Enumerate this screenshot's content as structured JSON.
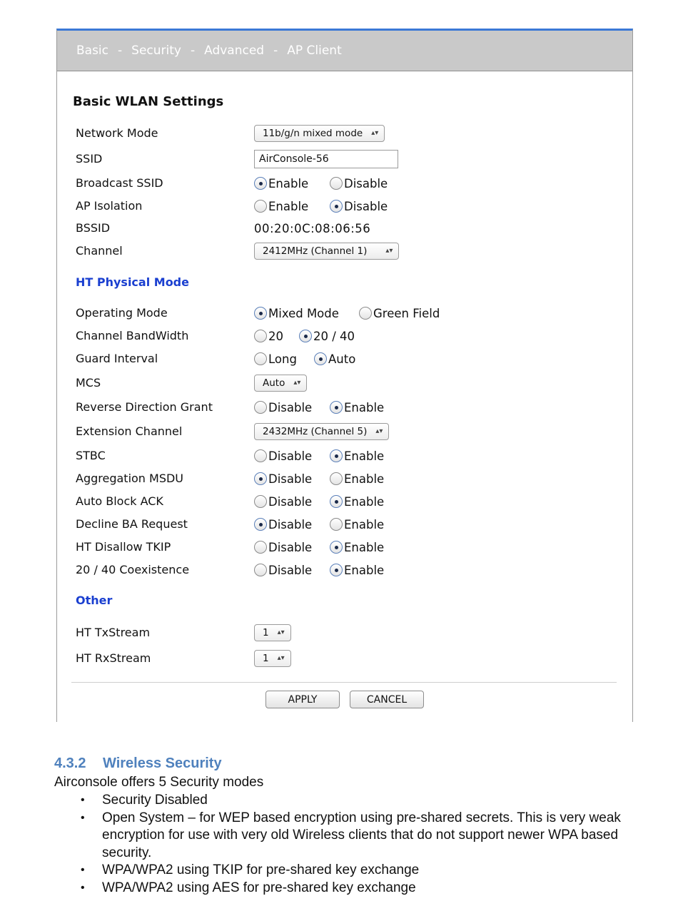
{
  "nav": {
    "items": [
      "Basic",
      "Security",
      "Advanced",
      "AP Client"
    ],
    "separator": "-"
  },
  "basic": {
    "title": "Basic WLAN Settings",
    "network_mode": {
      "label": "Network Mode",
      "value": "11b/g/n mixed mode"
    },
    "ssid": {
      "label": "SSID",
      "value": "AirConsole-56"
    },
    "broadcast_ssid": {
      "label": "Broadcast SSID",
      "options": [
        "Enable",
        "Disable"
      ],
      "selected": 0
    },
    "ap_isolation": {
      "label": "AP Isolation",
      "options": [
        "Enable",
        "Disable"
      ],
      "selected": 1
    },
    "bssid": {
      "label": "BSSID",
      "value": "00:20:0C:08:06:56"
    },
    "channel": {
      "label": "Channel",
      "value": "2412MHz (Channel 1)"
    }
  },
  "ht": {
    "title": "HT Physical Mode",
    "operating_mode": {
      "label": "Operating Mode",
      "options": [
        "Mixed Mode",
        "Green Field"
      ],
      "selected": 0
    },
    "bandwidth": {
      "label": "Channel BandWidth",
      "options": [
        "20",
        "20 / 40"
      ],
      "selected": 1
    },
    "guard_interval": {
      "label": "Guard Interval",
      "options": [
        "Long",
        "Auto"
      ],
      "selected": 1
    },
    "mcs": {
      "label": "MCS",
      "value": "Auto"
    },
    "rdg": {
      "label": "Reverse Direction Grant",
      "options": [
        "Disable",
        "Enable"
      ],
      "selected": 1
    },
    "extension_channel": {
      "label": "Extension Channel",
      "value": "2432MHz (Channel 5)"
    },
    "stbc": {
      "label": "STBC",
      "options": [
        "Disable",
        "Enable"
      ],
      "selected": 1
    },
    "amsdu": {
      "label": "Aggregation MSDU",
      "options": [
        "Disable",
        "Enable"
      ],
      "selected": 0
    },
    "auto_block_ack": {
      "label": "Auto Block ACK",
      "options": [
        "Disable",
        "Enable"
      ],
      "selected": 1
    },
    "decline_ba": {
      "label": "Decline BA Request",
      "options": [
        "Disable",
        "Enable"
      ],
      "selected": 0
    },
    "disallow_tkip": {
      "label": "HT Disallow TKIP",
      "options": [
        "Disable",
        "Enable"
      ],
      "selected": 1
    },
    "coexistence": {
      "label": "20 / 40 Coexistence",
      "options": [
        "Disable",
        "Enable"
      ],
      "selected": 1
    }
  },
  "other": {
    "title": "Other",
    "tx_stream": {
      "label": "HT TxStream",
      "value": "1"
    },
    "rx_stream": {
      "label": "HT RxStream",
      "value": "1"
    }
  },
  "buttons": {
    "apply": "APPLY",
    "cancel": "CANCEL"
  },
  "doc": {
    "section_number": "4.3.2",
    "section_title": "Wireless Security",
    "intro": "Airconsole offers 5 Security modes",
    "bullet_glyph": "•",
    "bullets": [
      "Security Disabled",
      "Open System – for WEP based encryption using pre-shared secrets. This is very weak encryption for use with very old Wireless clients that do not support newer WPA based security.",
      "WPA/WPA2 using TKIP for pre-shared key exchange",
      "WPA/WPA2 using AES for pre-shared key exchange"
    ]
  },
  "colors": {
    "nav_bar": "#c9c9c9",
    "nav_top_border": "#3b78d6",
    "subsection_title": "#1a3fd0",
    "doc_heading": "#4f81bd"
  }
}
